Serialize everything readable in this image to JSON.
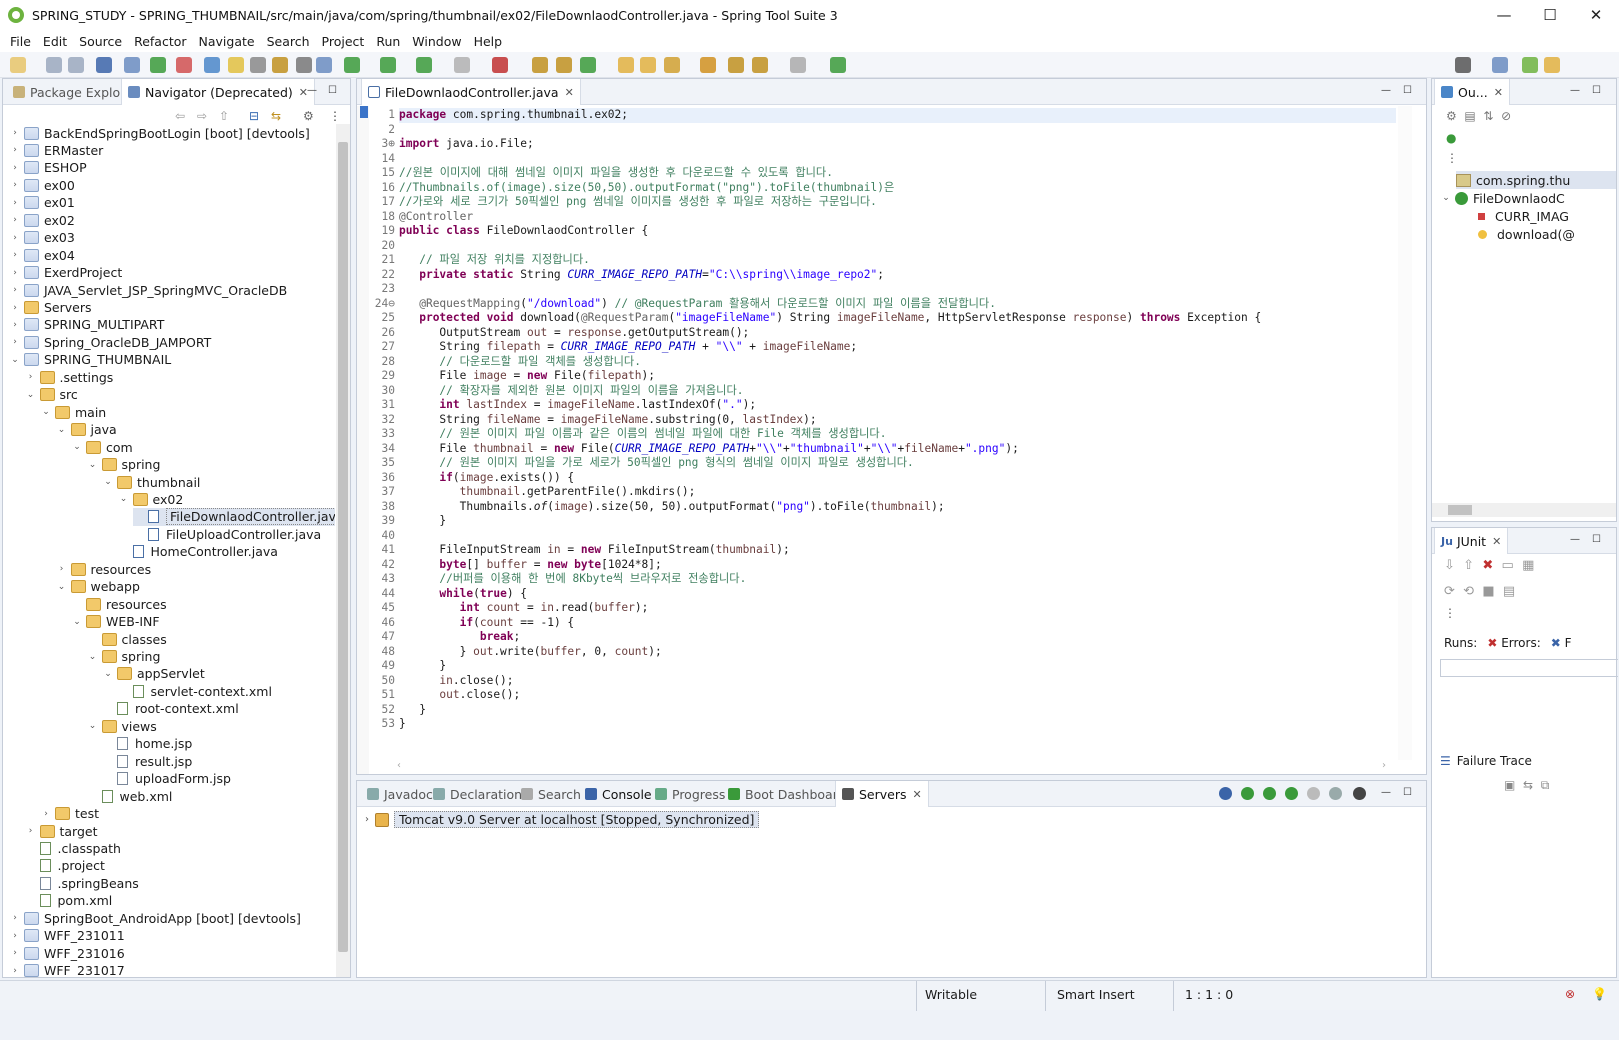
{
  "window": {
    "title": "SPRING_STUDY - SPRING_THUMBNAIL/src/main/java/com/spring/thumbnail/ex02/FileDownlaodController.java - Spring Tool Suite 3",
    "minimize": "—",
    "maximize": "☐",
    "close": "✕"
  },
  "menu": [
    "File",
    "Edit",
    "Source",
    "Refactor",
    "Navigate",
    "Search",
    "Project",
    "Run",
    "Window",
    "Help"
  ],
  "left_panel": {
    "tabs": [
      "Package Explorer",
      "Navigator (Deprecated)"
    ],
    "tree": [
      {
        "label": "BackEndSpringBootLogin [boot] [devtools]",
        "depth": 0,
        "icon": "proj",
        "twisty": "›"
      },
      {
        "label": "ERMaster",
        "depth": 0,
        "icon": "proj",
        "twisty": "›"
      },
      {
        "label": "ESHOP",
        "depth": 0,
        "icon": "proj",
        "twisty": "›"
      },
      {
        "label": "ex00",
        "depth": 0,
        "icon": "proj",
        "twisty": "›"
      },
      {
        "label": "ex01",
        "depth": 0,
        "icon": "proj",
        "twisty": "›"
      },
      {
        "label": "ex02",
        "depth": 0,
        "icon": "proj",
        "twisty": "›"
      },
      {
        "label": "ex03",
        "depth": 0,
        "icon": "proj",
        "twisty": "›"
      },
      {
        "label": "ex04",
        "depth": 0,
        "icon": "proj",
        "twisty": "›"
      },
      {
        "label": "ExerdProject",
        "depth": 0,
        "icon": "proj",
        "twisty": "›"
      },
      {
        "label": "JAVA_Servlet_JSP_SpringMVC_OracleDB",
        "depth": 0,
        "icon": "proj",
        "twisty": "›"
      },
      {
        "label": "Servers",
        "depth": 0,
        "icon": "fold",
        "twisty": "›"
      },
      {
        "label": "SPRING_MULTIPART",
        "depth": 0,
        "icon": "proj",
        "twisty": "›"
      },
      {
        "label": "Spring_OracleDB_JAMPORT",
        "depth": 0,
        "icon": "proj",
        "twisty": "›"
      },
      {
        "label": "SPRING_THUMBNAIL",
        "depth": 0,
        "icon": "proj",
        "twisty": "⌄"
      },
      {
        "label": ".settings",
        "depth": 1,
        "icon": "fold",
        "twisty": "›"
      },
      {
        "label": "src",
        "depth": 1,
        "icon": "fold",
        "twisty": "⌄"
      },
      {
        "label": "main",
        "depth": 2,
        "icon": "fold",
        "twisty": "⌄"
      },
      {
        "label": "java",
        "depth": 3,
        "icon": "fold",
        "twisty": "⌄"
      },
      {
        "label": "com",
        "depth": 4,
        "icon": "fold",
        "twisty": "⌄"
      },
      {
        "label": "spring",
        "depth": 5,
        "icon": "fold",
        "twisty": "⌄"
      },
      {
        "label": "thumbnail",
        "depth": 6,
        "icon": "fold",
        "twisty": "⌄"
      },
      {
        "label": "ex02",
        "depth": 7,
        "icon": "fold",
        "twisty": "⌄"
      },
      {
        "label": "FileDownlaodController.java",
        "depth": 8,
        "icon": "java",
        "twisty": "",
        "selected": true
      },
      {
        "label": "FileUploadController.java",
        "depth": 8,
        "icon": "java",
        "twisty": ""
      },
      {
        "label": "HomeController.java",
        "depth": 7,
        "icon": "java",
        "twisty": ""
      },
      {
        "label": "resources",
        "depth": 3,
        "icon": "fold",
        "twisty": "›"
      },
      {
        "label": "webapp",
        "depth": 3,
        "icon": "fold",
        "twisty": "⌄"
      },
      {
        "label": "resources",
        "depth": 4,
        "icon": "fold",
        "twisty": ""
      },
      {
        "label": "WEB-INF",
        "depth": 4,
        "icon": "fold",
        "twisty": "⌄"
      },
      {
        "label": "classes",
        "depth": 5,
        "icon": "fold",
        "twisty": ""
      },
      {
        "label": "spring",
        "depth": 5,
        "icon": "fold",
        "twisty": "⌄"
      },
      {
        "label": "appServlet",
        "depth": 6,
        "icon": "fold",
        "twisty": "⌄"
      },
      {
        "label": "servlet-context.xml",
        "depth": 7,
        "icon": "xml",
        "twisty": ""
      },
      {
        "label": "root-context.xml",
        "depth": 6,
        "icon": "xml",
        "twisty": ""
      },
      {
        "label": "views",
        "depth": 5,
        "icon": "fold",
        "twisty": "⌄"
      },
      {
        "label": "home.jsp",
        "depth": 6,
        "icon": "file",
        "twisty": ""
      },
      {
        "label": "result.jsp",
        "depth": 6,
        "icon": "file",
        "twisty": ""
      },
      {
        "label": "uploadForm.jsp",
        "depth": 6,
        "icon": "file",
        "twisty": ""
      },
      {
        "label": "web.xml",
        "depth": 5,
        "icon": "xml",
        "twisty": ""
      },
      {
        "label": "test",
        "depth": 2,
        "icon": "fold",
        "twisty": "›"
      },
      {
        "label": "target",
        "depth": 1,
        "icon": "fold",
        "twisty": "›"
      },
      {
        "label": ".classpath",
        "depth": 1,
        "icon": "xml",
        "twisty": ""
      },
      {
        "label": ".project",
        "depth": 1,
        "icon": "xml",
        "twisty": ""
      },
      {
        "label": ".springBeans",
        "depth": 1,
        "icon": "file",
        "twisty": ""
      },
      {
        "label": "pom.xml",
        "depth": 1,
        "icon": "xml",
        "twisty": ""
      },
      {
        "label": "SpringBoot_AndroidApp [boot] [devtools]",
        "depth": 0,
        "icon": "proj",
        "twisty": "›"
      },
      {
        "label": "WFF_231011",
        "depth": 0,
        "icon": "proj",
        "twisty": "›"
      },
      {
        "label": "WFF_231016",
        "depth": 0,
        "icon": "proj",
        "twisty": "›"
      },
      {
        "label": "WFF_231017",
        "depth": 0,
        "icon": "proj",
        "twisty": "›"
      }
    ]
  },
  "editor": {
    "tab": "FileDownlaodController.java",
    "lines": [
      {
        "n": "1",
        "html": "<span class='kw'>package</span> com.spring.thumbnail.ex02;"
      },
      {
        "n": "2",
        "html": ""
      },
      {
        "n": "3⊕",
        "html": "<span class='kw'>import</span> java.io.File;"
      },
      {
        "n": "14",
        "html": ""
      },
      {
        "n": "15",
        "html": "<span class='cm'>//원본 이미지에 대해 썸네일 이미지 파일을 생성한 후 다운로드할 수 있도록 합니다.</span>"
      },
      {
        "n": "16",
        "html": "<span class='cm'>//Thumbnails.of(image).size(50,50).outputFormat(\"png\").toFile(thumbnail)은</span>"
      },
      {
        "n": "17",
        "html": "<span class='cm'>//가로와 세로 크기가 50픽셀인 png 썸네일 이미지를 생성한 후 파일로 저장하는 구문입니다.</span>"
      },
      {
        "n": "18",
        "html": "<span class='ann'>@Controller</span>"
      },
      {
        "n": "19",
        "html": "<span class='kw'>public class</span> FileDownlaodController {"
      },
      {
        "n": "20",
        "html": ""
      },
      {
        "n": "21",
        "html": "   <span class='cm'>// 파일 저장 위치를 지정합니다.</span>"
      },
      {
        "n": "22",
        "html": "   <span class='kw'>private static</span> String <span class='fld'>CURR_IMAGE_REPO_PATH</span>=<span class='str'>\"C:\\\\spring\\\\image_repo2\"</span>;"
      },
      {
        "n": "23",
        "html": ""
      },
      {
        "n": "24⊖",
        "html": "   <span class='ann'>@RequestMapping</span>(<span class='str'>\"/download\"</span>) <span class='cm'>// @RequestParam 활용해서 다운로드할 이미지 파일 이름을 전달합니다.</span>"
      },
      {
        "n": "25",
        "html": "   <span class='kw'>protected void</span> download(<span class='ann'>@RequestParam</span>(<span class='str'>\"imageFileName\"</span>) String <span class='var'>imageFileName</span>, HttpServletResponse <span class='var'>response</span>) <span class='kw'>throws</span> Exception {"
      },
      {
        "n": "26",
        "html": "      OutputStream <span class='var'>out</span> = <span class='var'>response</span>.getOutputStream();"
      },
      {
        "n": "27",
        "html": "      String <span class='var'>filepath</span> = <span class='fld'>CURR_IMAGE_REPO_PATH</span> + <span class='str'>\"\\\\\"</span> + <span class='var'>imageFileName</span>;"
      },
      {
        "n": "28",
        "html": "      <span class='cm'>// 다운로드할 파일 객체를 생성합니다.</span>"
      },
      {
        "n": "29",
        "html": "      File <span class='var'>image</span> = <span class='kw'>new</span> File(<span class='var'>filepath</span>);"
      },
      {
        "n": "30",
        "html": "      <span class='cm'>// 확장자를 제외한 원본 이미지 파일의 이름을 가져옵니다.</span>"
      },
      {
        "n": "31",
        "html": "      <span class='kw'>int</span> <span class='var'>lastIndex</span> = <span class='var'>imageFileName</span>.lastIndexOf(<span class='str'>\".\"</span>);"
      },
      {
        "n": "32",
        "html": "      String <span class='var'>fileName</span> = <span class='var'>imageFileName</span>.substring(0, <span class='var'>lastIndex</span>);"
      },
      {
        "n": "33",
        "html": "      <span class='cm'>// 원본 이미지 파일 이름과 같은 이름의 썸네일 파일에 대한 File 객체를 생성합니다.</span>"
      },
      {
        "n": "34",
        "html": "      File <span class='var'>thumbnail</span> = <span class='kw'>new</span> File(<span class='fld'>CURR_IMAGE_REPO_PATH</span>+<span class='str'>\"\\\\\"</span>+<span class='str'>\"thumbnail\"</span>+<span class='str'>\"\\\\\"</span>+<span class='var'>fileName</span>+<span class='str'>\".png\"</span>);"
      },
      {
        "n": "35",
        "html": "      <span class='cm'>// 원본 이미지 파일을 가로 세로가 50픽셀인 png 형식의 썸네일 이미지 파일로 생성합니다.</span>"
      },
      {
        "n": "36",
        "html": "      <span class='kw'>if</span>(<span class='var'>image</span>.exists()) {"
      },
      {
        "n": "37",
        "html": "         <span class='var'>thumbnail</span>.getParentFile().mkdirs();"
      },
      {
        "n": "38",
        "html": "         Thumbnails.<i>of</i>(<span class='var'>image</span>).size(50, 50).outputFormat(<span class='str'>\"png\"</span>).toFile(<span class='var'>thumbnail</span>);"
      },
      {
        "n": "39",
        "html": "      }"
      },
      {
        "n": "40",
        "html": ""
      },
      {
        "n": "41",
        "html": "      FileInputStream <span class='var'>in</span> = <span class='kw'>new</span> FileInputStream(<span class='var'>thumbnail</span>);"
      },
      {
        "n": "42",
        "html": "      <span class='kw'>byte</span>[] <span class='var'>buffer</span> = <span class='kw'>new byte</span>[1024*8];"
      },
      {
        "n": "43",
        "html": "      <span class='cm'>//버퍼를 이용해 한 번에 8Kbyte씩 브라우저로 전송합니다.</span>"
      },
      {
        "n": "44",
        "html": "      <span class='kw'>while</span>(<span class='kw'>true</span>) {"
      },
      {
        "n": "45",
        "html": "         <span class='kw'>int</span> <span class='var'>count</span> = <span class='var'>in</span>.read(<span class='var'>buffer</span>);"
      },
      {
        "n": "46",
        "html": "         <span class='kw'>if</span>(<span class='var'>count</span> == -1) {"
      },
      {
        "n": "47",
        "html": "            <span class='kw'>break</span>;"
      },
      {
        "n": "48",
        "html": "         } <span class='var'>out</span>.write(<span class='var'>buffer</span>, 0, <span class='var'>count</span>);"
      },
      {
        "n": "49",
        "html": "      }"
      },
      {
        "n": "50",
        "html": "      <span class='var'>in</span>.close();"
      },
      {
        "n": "51",
        "html": "      <span class='var'>out</span>.close();"
      },
      {
        "n": "52",
        "html": "   }"
      },
      {
        "n": "53",
        "html": "}"
      }
    ]
  },
  "bottom_panel": {
    "tabs": [
      "Javadoc",
      "Declaration",
      "Search",
      "Console",
      "Progress",
      "Boot Dashboard",
      "Servers"
    ],
    "server_row": "Tomcat v9.0 Server at localhost  [Stopped, Synchronized]"
  },
  "outline": {
    "tab": "Ou...",
    "items": [
      "com.spring.thu",
      "FileDownlaodC",
      "CURR_IMAG",
      "download(@"
    ]
  },
  "junit": {
    "tab": "JUnit",
    "runs_label": "Runs:",
    "errors_label": "Errors:",
    "failures_label": "F",
    "failure_trace": "Failure Trace"
  },
  "status": {
    "writable": "Writable",
    "insert_mode": "Smart Insert",
    "position": "1 : 1 : 0"
  }
}
